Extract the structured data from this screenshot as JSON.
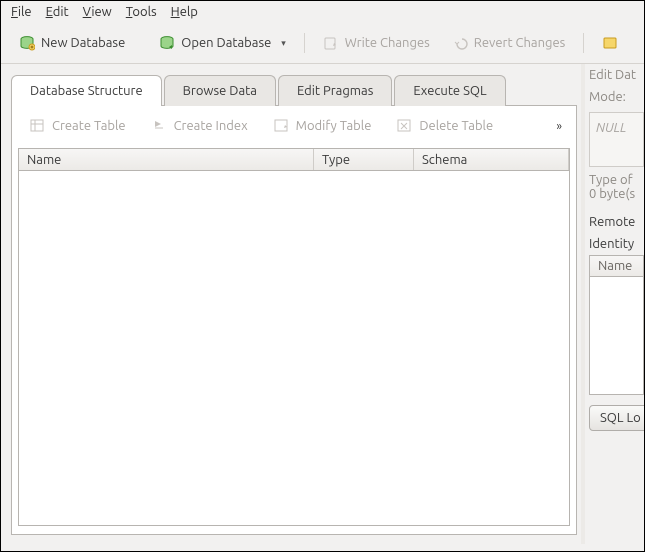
{
  "menu": {
    "file": "File",
    "edit": "Edit",
    "view": "View",
    "tools": "Tools",
    "help": "Help"
  },
  "toolbar": {
    "new_db": "New Database",
    "open_db": "Open Database",
    "write_changes": "Write Changes",
    "revert_changes": "Revert Changes"
  },
  "tabs": {
    "structure": "Database Structure",
    "browse": "Browse Data",
    "pragmas": "Edit Pragmas",
    "execute": "Execute SQL"
  },
  "structure_toolbar": {
    "create_table": "Create Table",
    "create_index": "Create Index",
    "modify_table": "Modify Table",
    "delete_table": "Delete Table"
  },
  "columns": {
    "name": "Name",
    "type": "Type",
    "schema": "Schema"
  },
  "side": {
    "edit_heading": "Edit Dat",
    "mode_label": "Mode:",
    "null_placeholder": "NULL",
    "type_of": "Type of",
    "bytes": "0 byte(s",
    "remote": "Remote",
    "identity": "Identity",
    "name_col": "Name",
    "sql_log": "SQL Lo"
  }
}
